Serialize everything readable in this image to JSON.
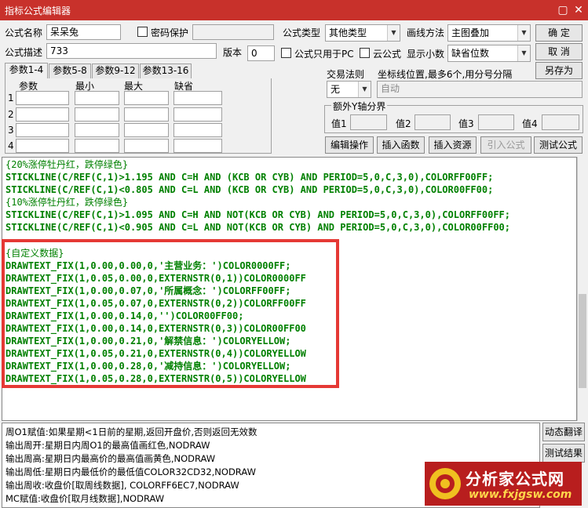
{
  "window": {
    "title": "指标公式编辑器",
    "close_icon": "close-icon",
    "maximize_icon": "maximize-icon"
  },
  "form": {
    "name_label": "公式名称",
    "name_value": "呆呆兔",
    "password_label": "密码保护",
    "desc_label": "公式描述",
    "desc_value": "733",
    "version_label": "版本",
    "version_value": "0",
    "pc_only_label": "公式只用于PC",
    "cloud_label": "云公式",
    "type_label": "公式类型",
    "type_value": "其他类型",
    "draw_label": "画线方法",
    "draw_value": "主图叠加",
    "decimals_label": "显示小数",
    "decimals_value": "缺省位数"
  },
  "buttons": {
    "ok": "确  定",
    "cancel": "取  消",
    "save_as": "另存为",
    "edit_ops": "编辑操作",
    "insert_func": "插入函数",
    "insert_res": "插入资源",
    "import_formula": "引入公式",
    "test_formula": "测试公式",
    "dyn_translate": "动态翻译",
    "test_result": "测试结果"
  },
  "tabs": [
    "参数1-4",
    "参数5-8",
    "参数9-12",
    "参数13-16"
  ],
  "params": {
    "headers": [
      "参数",
      "最小",
      "最大",
      "缺省"
    ],
    "rows": [
      "1",
      "2",
      "3",
      "4"
    ]
  },
  "trade_rule": {
    "label": "交易法则",
    "value": "无",
    "axis_hint": "坐标线位置,最多6个,用分号分隔",
    "axis_value": "自动"
  },
  "yaxis": {
    "title": "额外Y轴分界",
    "labels": [
      "值1",
      "值2",
      "值3",
      "值4"
    ]
  },
  "code_lines": [
    "{20%涨停牡丹红，跌停绿色}",
    "STICKLINE(C/REF(C,1)>1.195 AND C=H AND (KCB OR CYB) AND PERIOD=5,0,C,3,0),COLORFF00FF;",
    "STICKLINE(C/REF(C,1)<0.805 AND C=L AND (KCB OR CYB) AND PERIOD=5,0,C,3,0),COLOR00FF00;",
    "{10%涨停牡丹红，跌停绿色}",
    "STICKLINE(C/REF(C,1)>1.095 AND C=H AND NOT(KCB OR CYB) AND PERIOD=5,0,C,3,0),COLORFF00FF;",
    "STICKLINE(C/REF(C,1)<0.905 AND C=L AND NOT(KCB OR CYB) AND PERIOD=5,0,C,3,0),COLOR00FF00;",
    "{自定义数据}",
    "DRAWTEXT_FIX(1,0.00,0.00,0,'主营业务：')COLOR0000FF;",
    "DRAWTEXT_FIX(1,0.05,0.00,0,EXTERNSTR(0,1))COLOR0000FF",
    "DRAWTEXT_FIX(1,0.00,0.07,0,'所属概念：')COLORFF00FF;",
    "DRAWTEXT_FIX(1,0.05,0.07,0,EXTERNSTR(0,2))COLORFF00FF",
    "DRAWTEXT_FIX(1,0.00,0.14,0,'')COLOR00FF00;",
    "DRAWTEXT_FIX(1,0.00,0.14,0,EXTERNSTR(0,3))COLOR00FF00",
    "DRAWTEXT_FIX(1,0.00,0.21,0,'解禁信息：')COLORYELLOW;",
    "DRAWTEXT_FIX(1,0.05,0.21,0,EXTERNSTR(0,4))COLORYELLOW",
    "DRAWTEXT_FIX(1,0.00,0.28,0,'减持信息：')COLORYELLOW;",
    "DRAWTEXT_FIX(1,0.05,0.28,0,EXTERNSTR(0,5))COLORYELLOW"
  ],
  "description_lines": [
    "周O1赋值:如果星期<1日前的星期,返回开盘价,否则返回无效数",
    "输出周开:星期日内周O1的最高值画红色,NODRAW",
    "输出周高:星期日内最高价的最高值画黄色,NODRAW",
    "输出周低:星期日内最低价的最低值COLOR32CD32,NODRAW",
    "输出周收:收盘价[取周线数据], COLORFF6EC7,NODRAW",
    "MC赋值:收盘价[取月线数据],NODRAW"
  ],
  "watermark": {
    "title": "分析家公式网",
    "url": "www.fxjgsw.com"
  },
  "colors": {
    "titlebar": "#c8312b",
    "highlight_box": "#e53935",
    "code_green": "#008000",
    "number_red": "#c02020"
  }
}
